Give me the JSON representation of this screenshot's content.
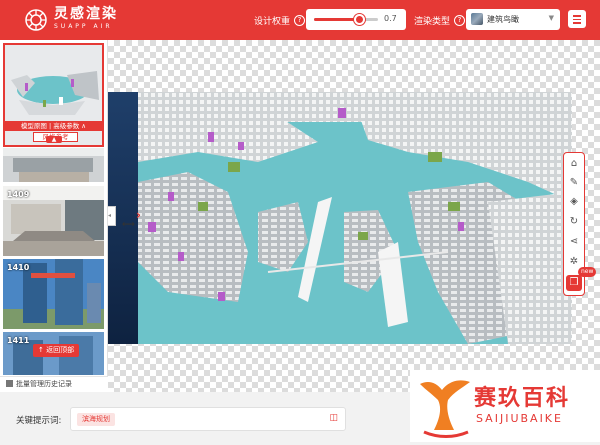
{
  "brand": {
    "name_cn": "灵感渲染",
    "name_en": "SUAPP AIR"
  },
  "header": {
    "weight_label": "设计权重",
    "weight_value": "0.7",
    "weight_level": 0.7,
    "render_type_label": "渲染类型",
    "render_type_value": "建筑鸟瞰"
  },
  "sidebar": {
    "thumbnails": [
      {
        "label": "",
        "tag": "模型原图 | 高级参数 ∧",
        "sub": "风格参考"
      },
      {
        "label": ""
      },
      {
        "label": "1409"
      },
      {
        "label": "1410"
      },
      {
        "label": "1411"
      }
    ],
    "back_to_top": "↑ 返回顶部",
    "batch_history": "批量管理历史记录"
  },
  "toolbar": {
    "icons": [
      "home-icon",
      "edit-icon",
      "layers-icon",
      "refresh-icon",
      "share-icon",
      "settings-icon",
      "cube-icon"
    ],
    "new_badge": "new"
  },
  "prompt": {
    "label": "关键提示词:",
    "chip": "滨海规划"
  },
  "watermark": {
    "text": "赛玖百科",
    "sub": "SAIJIUBAIKE"
  },
  "colors": {
    "accent": "#e53935",
    "water": "#6cc3c9"
  }
}
